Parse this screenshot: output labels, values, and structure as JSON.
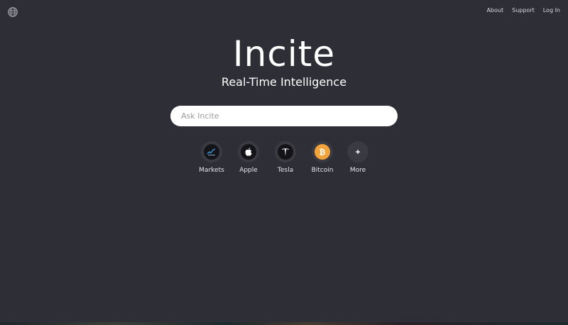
{
  "header": {
    "logo_icon": "globe-icon",
    "nav": [
      {
        "label": "About"
      },
      {
        "label": "Support"
      },
      {
        "label": "Log In"
      }
    ]
  },
  "hero": {
    "title": "Incite",
    "subtitle": "Real-Time Intelligence"
  },
  "search": {
    "placeholder": "Ask Incite",
    "value": ""
  },
  "shortcuts": [
    {
      "label": "Markets",
      "icon": "markets-chart-icon"
    },
    {
      "label": "Apple",
      "icon": "apple-icon"
    },
    {
      "label": "Tesla",
      "icon": "tesla-icon"
    },
    {
      "label": "Bitcoin",
      "icon": "bitcoin-icon"
    },
    {
      "label": "More",
      "icon": "plus-icon"
    }
  ],
  "colors": {
    "background": "#2e2e36",
    "text": "#ffffff",
    "bitcoin": "#f2a33a",
    "markets_accent": "#3aa0e0"
  }
}
